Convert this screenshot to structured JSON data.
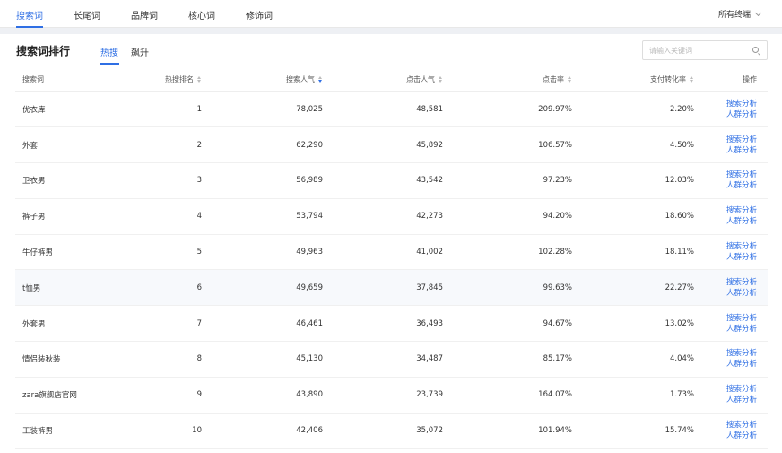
{
  "nav": {
    "tabs": [
      "搜索词",
      "长尾词",
      "品牌词",
      "核心词",
      "修饰词"
    ],
    "terminal": "所有终端"
  },
  "section": {
    "title": "搜索词排行",
    "subtabs": [
      "热搜",
      "飙升"
    ],
    "search_placeholder": "请输入关键词"
  },
  "table": {
    "headers": [
      "搜索词",
      "热搜排名",
      "搜索人气",
      "点击人气",
      "点击率",
      "支付转化率",
      "操作"
    ],
    "action_labels": [
      "搜索分析",
      "人群分析"
    ],
    "rows": [
      {
        "kw": "优衣库",
        "rank": "1",
        "search": "78,025",
        "click": "48,581",
        "ctr": "209.97%",
        "conv": "2.20%"
      },
      {
        "kw": "外套",
        "rank": "2",
        "search": "62,290",
        "click": "45,892",
        "ctr": "106.57%",
        "conv": "4.50%"
      },
      {
        "kw": "卫衣男",
        "rank": "3",
        "search": "56,989",
        "click": "43,542",
        "ctr": "97.23%",
        "conv": "12.03%"
      },
      {
        "kw": "裤子男",
        "rank": "4",
        "search": "53,794",
        "click": "42,273",
        "ctr": "94.20%",
        "conv": "18.60%"
      },
      {
        "kw": "牛仔裤男",
        "rank": "5",
        "search": "49,963",
        "click": "41,002",
        "ctr": "102.28%",
        "conv": "18.11%"
      },
      {
        "kw": "t恤男",
        "rank": "6",
        "search": "49,659",
        "click": "37,845",
        "ctr": "99.63%",
        "conv": "22.27%"
      },
      {
        "kw": "外套男",
        "rank": "7",
        "search": "46,461",
        "click": "36,493",
        "ctr": "94.67%",
        "conv": "13.02%"
      },
      {
        "kw": "情侣装秋装",
        "rank": "8",
        "search": "45,130",
        "click": "34,487",
        "ctr": "85.17%",
        "conv": "4.04%"
      },
      {
        "kw": "zara旗舰店官网",
        "rank": "9",
        "search": "43,890",
        "click": "23,739",
        "ctr": "164.07%",
        "conv": "1.73%"
      },
      {
        "kw": "工装裤男",
        "rank": "10",
        "search": "42,406",
        "click": "35,072",
        "ctr": "101.94%",
        "conv": "15.74%"
      }
    ]
  },
  "colors": {
    "accent": "#2f6fe4",
    "highlight_row": "#f7f9fc"
  }
}
